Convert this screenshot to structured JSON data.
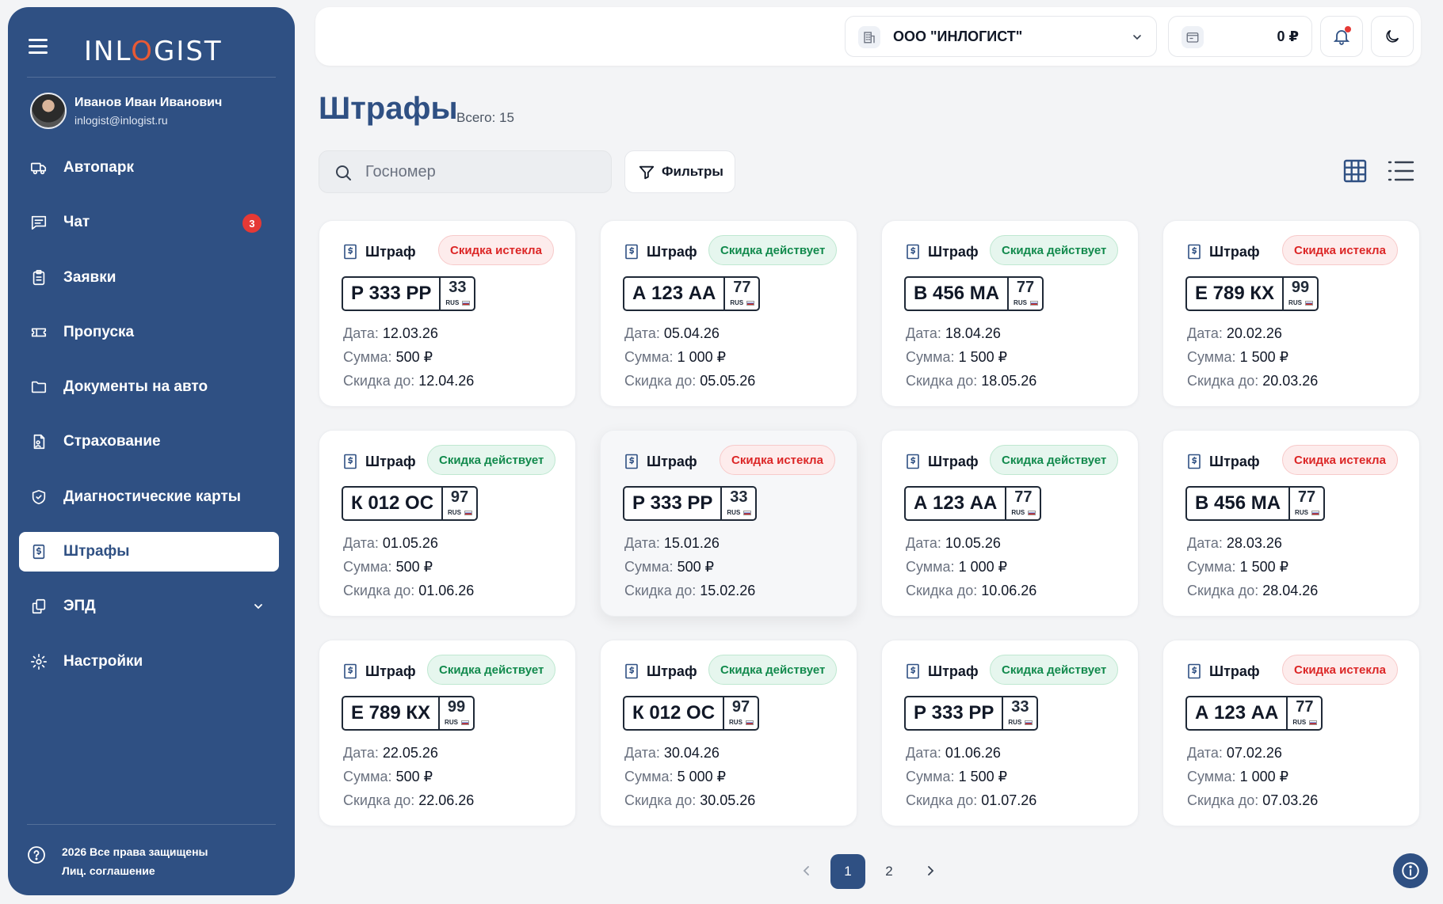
{
  "app": {
    "logo_text_pre": "INL",
    "logo_text_o": "O",
    "logo_text_post": "GIST"
  },
  "user": {
    "name": "Иванов Иван Иванович",
    "email": "inlogist@inlogist.ru"
  },
  "sidebar": {
    "items": [
      {
        "label": "Автопарк",
        "icon": "truck-icon"
      },
      {
        "label": "Чат",
        "icon": "chat-icon",
        "badge": "3"
      },
      {
        "label": "Заявки",
        "icon": "clipboard-icon"
      },
      {
        "label": "Пропуска",
        "icon": "ticket-icon"
      },
      {
        "label": "Документы на авто",
        "icon": "folder-icon"
      },
      {
        "label": "Страхование",
        "icon": "insurance-doc-icon"
      },
      {
        "label": "Диагностические карты",
        "icon": "shield-check-icon"
      },
      {
        "label": "Штрафы",
        "icon": "fine-doc-icon",
        "active": true
      },
      {
        "label": "ЭПД",
        "icon": "copy-icon"
      },
      {
        "label": "Настройки",
        "icon": "gear-icon"
      }
    ],
    "footer_copyright": "2026 Все права защищены",
    "footer_agreement": "Лиц. соглашение"
  },
  "topbar": {
    "company": "ООО \"ИНЛОГИСТ\"",
    "balance": "0 ₽"
  },
  "page": {
    "title": "Штрафы",
    "count_label": "Всего: 15",
    "search_placeholder": "Госномер",
    "filters_label": "Фильтры"
  },
  "labels": {
    "card_type": "Штраф",
    "date": "Дата: ",
    "sum": "Сумма: ",
    "discount_until": "Скидка до: ",
    "rus": "RUS"
  },
  "cards": [
    {
      "status": "Скидка истекла",
      "status_kind": "expired",
      "plate": "Р 333 РР",
      "region": "33",
      "date": "12.03.26",
      "sum": "500 ₽",
      "discount": "12.04.26"
    },
    {
      "status": "Скидка действует",
      "status_kind": "active",
      "plate": "А 123 АА",
      "region": "77",
      "date": "05.04.26",
      "sum": "1 000 ₽",
      "discount": "05.05.26"
    },
    {
      "status": "Скидка действует",
      "status_kind": "active",
      "plate": "В 456 МА",
      "region": "77",
      "date": "18.04.26",
      "sum": "1 500 ₽",
      "discount": "18.05.26"
    },
    {
      "status": "Скидка истекла",
      "status_kind": "expired",
      "plate": "Е 789 КХ",
      "region": "99",
      "date": "20.02.26",
      "sum": "1 500 ₽",
      "discount": "20.03.26"
    },
    {
      "status": "Скидка действует",
      "status_kind": "active",
      "plate": "К 012 ОС",
      "region": "97",
      "date": "01.05.26",
      "sum": "500 ₽",
      "discount": "01.06.26"
    },
    {
      "status": "Скидка истекла",
      "status_kind": "expired",
      "plate": "Р 333 РР",
      "region": "33",
      "date": "15.01.26",
      "sum": "500 ₽",
      "discount": "15.02.26"
    },
    {
      "status": "Скидка действует",
      "status_kind": "active",
      "plate": "А 123 АА",
      "region": "77",
      "date": "10.05.26",
      "sum": "1 000 ₽",
      "discount": "10.06.26"
    },
    {
      "status": "Скидка истекла",
      "status_kind": "expired",
      "plate": "В 456 МА",
      "region": "77",
      "date": "28.03.26",
      "sum": "1 500 ₽",
      "discount": "28.04.26"
    },
    {
      "status": "Скидка действует",
      "status_kind": "active",
      "plate": "Е 789 КХ",
      "region": "99",
      "date": "22.05.26",
      "sum": "500 ₽",
      "discount": "22.06.26"
    },
    {
      "status": "Скидка действует",
      "status_kind": "active",
      "plate": "К 012 ОС",
      "region": "97",
      "date": "30.04.26",
      "sum": "5 000 ₽",
      "discount": "30.05.26"
    },
    {
      "status": "Скидка действует",
      "status_kind": "active",
      "plate": "Р 333 РР",
      "region": "33",
      "date": "01.06.26",
      "sum": "1 500 ₽",
      "discount": "01.07.26"
    },
    {
      "status": "Скидка истекла",
      "status_kind": "expired",
      "plate": "А 123 АА",
      "region": "77",
      "date": "07.02.26",
      "sum": "1 000 ₽",
      "discount": "07.03.26"
    }
  ],
  "pagination": {
    "pages": [
      "1",
      "2"
    ],
    "current": "1"
  },
  "colors": {
    "brand": "#2f5083",
    "accent_logo": "#e85a35",
    "badge_red": "#e53935",
    "status_expired": "#dc2626",
    "status_active": "#128a4d"
  }
}
